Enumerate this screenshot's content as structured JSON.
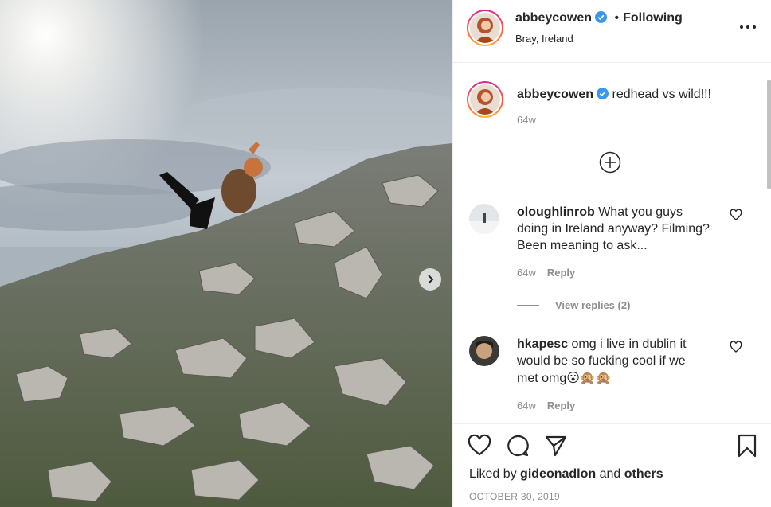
{
  "post": {
    "author": "abbeycowen",
    "follow_status": "Following",
    "separator": "•",
    "location": "Bray, Ireland",
    "more_icon": "more-horizontal-icon"
  },
  "caption": {
    "username": "abbeycowen",
    "text": "redhead vs wild!!!",
    "age": "64w"
  },
  "comments": [
    {
      "username": "oloughlinrob",
      "text": "What you guys doing in Ireland anyway? Filming? Been meaning to ask...",
      "age": "64w",
      "reply_label": "Reply",
      "view_replies": "View replies (2)"
    },
    {
      "username": "hkapesc",
      "text": "omg i live in dublin it would be so fucking cool if we met omg",
      "emojis": "😮🙊🙊",
      "age": "64w",
      "reply_label": "Reply"
    }
  ],
  "footer": {
    "liked_by_prefix": "Liked by",
    "liked_by_user": "gideonadlon",
    "liked_by_and": "and",
    "liked_by_others": "others",
    "date": "OCTOBER 30, 2019"
  },
  "colors": {
    "verified_blue": "#3897f0",
    "muted_text": "#8e8e8e",
    "primary_text": "#262626"
  }
}
